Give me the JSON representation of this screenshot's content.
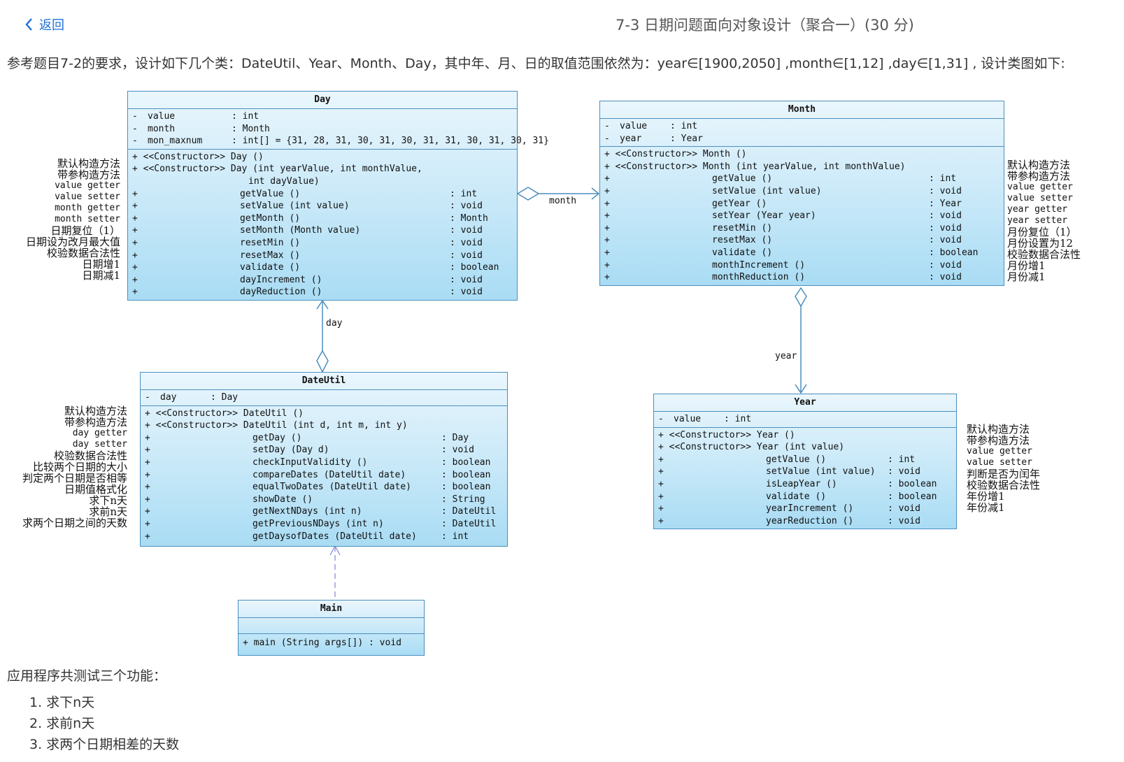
{
  "nav": {
    "back_label": "返回",
    "page_title": "7-3 日期问题面向对象设计（聚合一）(30 分)"
  },
  "intro": "参考题目7-2的要求，设计如下几个类：DateUtil、Year、Month、Day，其中年、月、日的取值范围依然为：year∈[1900,2050] ,month∈[1,12] ,day∈[1,31] , 设计类图如下:",
  "diagram": {
    "day": {
      "name": "Day",
      "attrs": [
        [
          "-",
          "value",
          ": int"
        ],
        [
          "-",
          "month",
          ": Month"
        ],
        [
          "-",
          "mon_maxnum",
          ": int[]   = {31, 28, 31, 30, 31, 30, 31, 31, 30, 31, 30, 31}"
        ]
      ],
      "ctor1": "+  <<Constructor>>  Day  ()",
      "ctor2a": "+  <<Constructor>>  Day  (int yearValue,  int monthValue,",
      "ctor2b": "int dayValue)",
      "methods": [
        [
          "getValue  ()",
          ": int"
        ],
        [
          "setValue  (int value)",
          ": void"
        ],
        [
          "getMonth  ()",
          ": Month"
        ],
        [
          "setMonth  (Month value)",
          ": void"
        ],
        [
          "resetMin  ()",
          ": void"
        ],
        [
          "resetMax  ()",
          ": void"
        ],
        [
          "validate  ()",
          ": boolean"
        ],
        [
          "dayIncrement  ()",
          ": void"
        ],
        [
          "dayReduction  ()",
          ": void"
        ]
      ],
      "notes": [
        "默认构造方法",
        "带参构造方法",
        "value getter",
        "value setter",
        "month getter",
        "month setter",
        "日期复位（1）",
        "日期设为改月最大值",
        "校验数据合法性",
        "日期增1",
        "日期减1"
      ]
    },
    "month": {
      "name": "Month",
      "attrs": [
        [
          "-",
          "value",
          ": int"
        ],
        [
          "-",
          "year",
          ": Year"
        ]
      ],
      "ctor1": "+  <<Constructor>>  Month  ()",
      "ctor2a": "+  <<Constructor>>  Month  (int yearValue,  int monthValue)",
      "methods": [
        [
          "getValue  ()",
          ": int"
        ],
        [
          "setValue  (int value)",
          ": void"
        ],
        [
          "getYear  ()",
          ": Year"
        ],
        [
          "setYear  (Year year)",
          ": void"
        ],
        [
          "resetMin  ()",
          ": void"
        ],
        [
          "resetMax  ()",
          ": void"
        ],
        [
          "validate  ()",
          ": boolean"
        ],
        [
          "monthIncrement  ()",
          ": void"
        ],
        [
          "monthReduction  ()",
          ": void"
        ]
      ],
      "notes": [
        "默认构造方法",
        "带参构造方法",
        "value getter",
        "value setter",
        "year getter",
        "year setter",
        "月份复位（1）",
        "月份设置为12",
        "校验数据合法性",
        "月份增1",
        "月份减1"
      ]
    },
    "dateutil": {
      "name": "DateUtil",
      "attrs": [
        [
          "-",
          "day",
          ": Day"
        ]
      ],
      "ctor1": "+  <<Constructor>>  DateUtil  ()",
      "ctor2a": "+  <<Constructor>>  DateUtil  (int d,  int m,  int y)",
      "methods": [
        [
          "getDay  ()",
          ": Day"
        ],
        [
          "setDay  (Day d)",
          ": void"
        ],
        [
          "checkInputValidity  ()",
          ": boolean"
        ],
        [
          "compareDates  (DateUtil date)",
          ": boolean"
        ],
        [
          "equalTwoDates  (DateUtil date)",
          ": boolean"
        ],
        [
          "showDate  ()",
          ": String"
        ],
        [
          "getNextNDays  (int n)",
          ": DateUtil"
        ],
        [
          "getPreviousNDays  (int n)",
          ": DateUtil"
        ],
        [
          "getDaysofDates  (DateUtil date)",
          ": int"
        ]
      ],
      "notes": [
        "默认构造方法",
        "带参构造方法",
        "day getter",
        "day setter",
        "校验数据合法性",
        "比较两个日期的大小",
        "判定两个日期是否相等",
        "日期值格式化",
        "求下n天",
        "求前n天",
        "求两个日期之间的天数"
      ]
    },
    "year": {
      "name": "Year",
      "attrs": [
        [
          "-",
          "value",
          ": int"
        ]
      ],
      "ctor1": "+  <<Constructor>>  Year  ()",
      "ctor2a": "+  <<Constructor>>  Year  (int value)",
      "methods": [
        [
          "getValue  ()",
          ": int"
        ],
        [
          "setValue  (int value)",
          ": void"
        ],
        [
          "isLeapYear  ()",
          ": boolean"
        ],
        [
          "validate  ()",
          ": boolean"
        ],
        [
          "yearIncrement  ()",
          ": void"
        ],
        [
          "yearReduction  ()",
          ": void"
        ]
      ],
      "notes": [
        "默认构造方法",
        "带参构造方法",
        "value getter",
        "value setter",
        "判断是否为闰年",
        "校验数据合法性",
        "年份增1",
        "年份减1"
      ]
    },
    "main": {
      "name": "Main",
      "method": "+  main  (String args[])   : void"
    },
    "assoc": {
      "month": "month",
      "day": "day",
      "year": "year"
    }
  },
  "outro": "应用程序共测试三个功能：",
  "features": [
    "1. 求下n天",
    "2. 求前n天",
    "3. 求两个日期相差的天数"
  ],
  "colors": {
    "link": "#1e6fd9",
    "uml_border": "#4a8fbe",
    "uml_fill": "#c7e8f8"
  }
}
